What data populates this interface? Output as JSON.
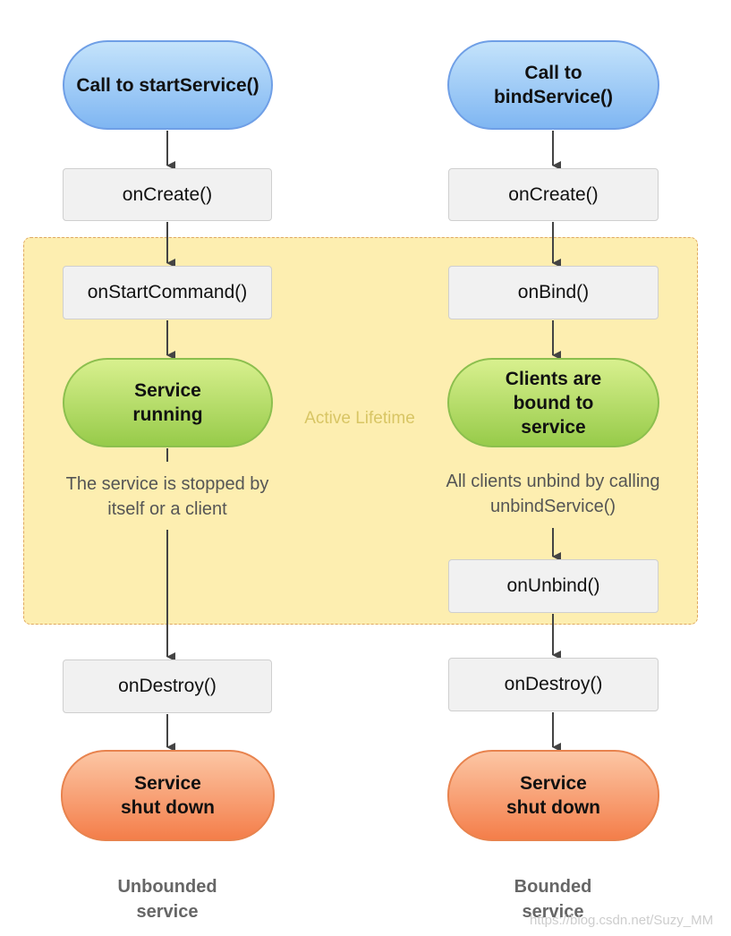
{
  "region": {
    "label": "Active Lifetime"
  },
  "unbounded": {
    "start": "Call to startService()",
    "on_create": "onCreate()",
    "on_start_command": "onStartCommand()",
    "running": "Service running",
    "note": "The service is stopped by itself or a client",
    "on_destroy": "onDestroy()",
    "end": "Service shut down",
    "caption": "Unbounded service"
  },
  "bounded": {
    "start": "Call to bindService()",
    "on_create": "onCreate()",
    "on_bind": "onBind()",
    "running": "Clients are bound to service",
    "note": "All clients unbind by calling unbindService()",
    "on_unbind": "onUnbind()",
    "on_destroy": "onDestroy()",
    "end": "Service shut down",
    "caption": "Bounded service"
  },
  "watermark": "https://blog.csdn.net/Suzy_MM",
  "colors": {
    "start": "#8fc0f4",
    "running": "#a9d65a",
    "end": "#f68c5a",
    "region": "#fdeeb0"
  }
}
